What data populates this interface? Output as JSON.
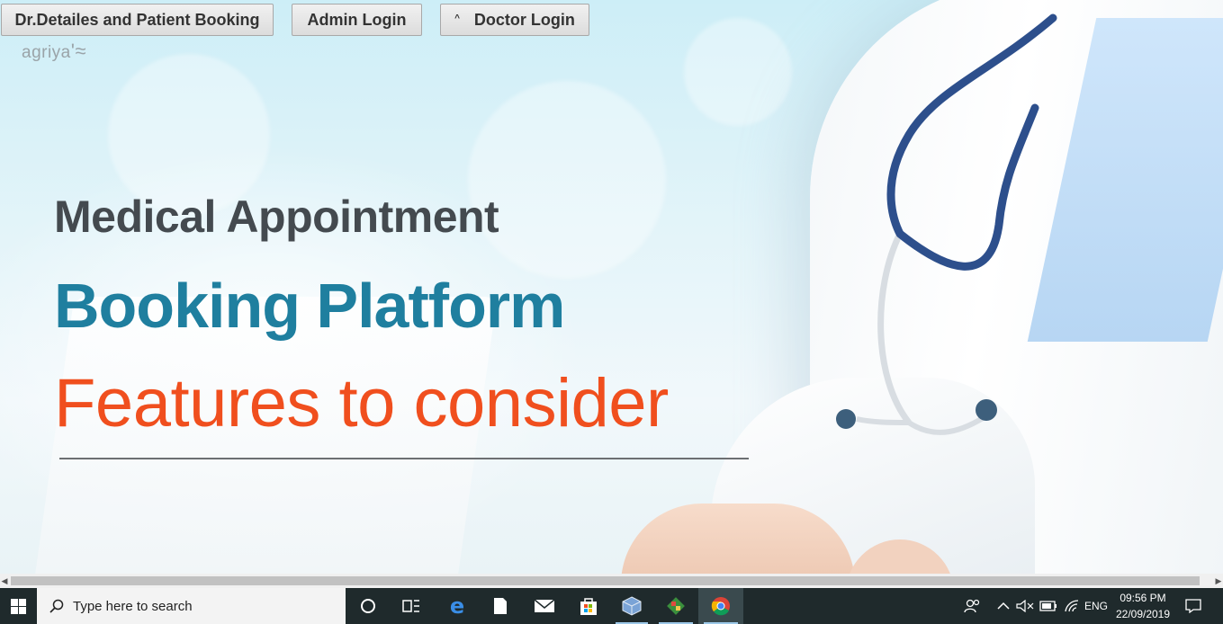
{
  "nav": {
    "booking_label": "Dr.Detailes and Patient Booking",
    "admin_label": "Admin Login",
    "doctor_label": "Doctor Login",
    "doctor_caret": "^"
  },
  "hero": {
    "logo": "agriya",
    "line1": "Medical Appointment",
    "line2": "Booking Platform",
    "line3": "Features to consider"
  },
  "scrollbar": {
    "left_arrow": "◀",
    "right_arrow": "▶"
  },
  "taskbar": {
    "search_placeholder": "Type here to search",
    "language": "ENG",
    "time": "09:56 PM",
    "date": "22/09/2019"
  },
  "icons": [
    "windows-start-icon",
    "search-icon",
    "cortana-icon",
    "task-view-icon",
    "edge-icon",
    "file-explorer-icon",
    "mail-icon",
    "store-icon",
    "virtualbox-icon",
    "git-icon",
    "chrome-icon",
    "people-icon",
    "show-hidden-icon",
    "volume-muted-icon",
    "battery-icon",
    "wifi-icon",
    "notification-icon"
  ]
}
